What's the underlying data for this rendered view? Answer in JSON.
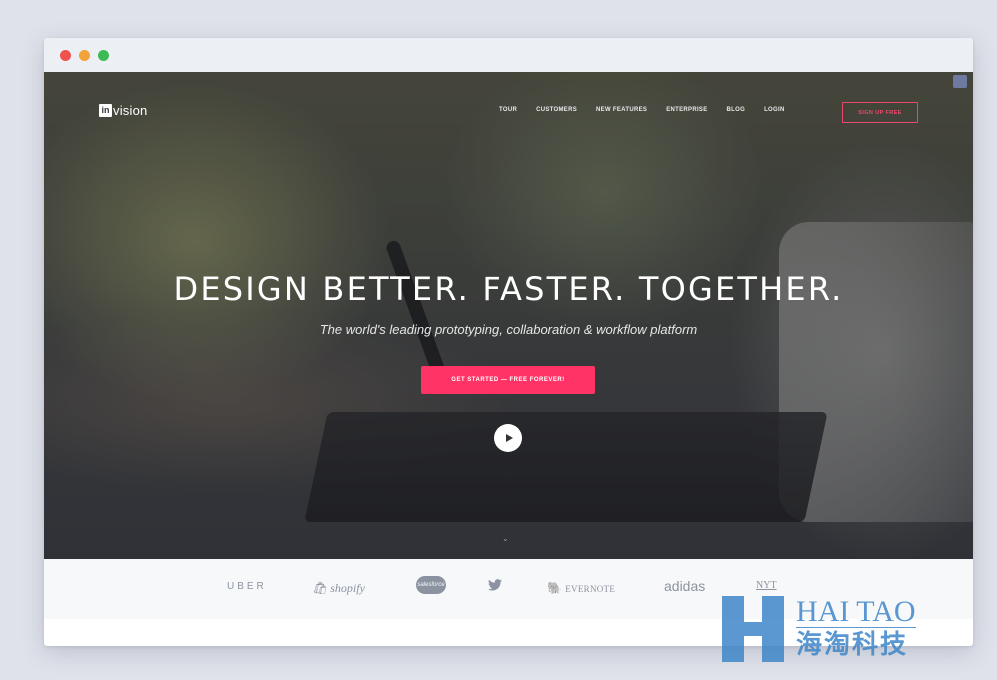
{
  "window": {
    "controls": [
      "close",
      "minimize",
      "maximize"
    ]
  },
  "header": {
    "logo_mark": "in",
    "logo_text": "vision",
    "nav": [
      {
        "label": "TOUR"
      },
      {
        "label": "CUSTOMERS"
      },
      {
        "label": "NEW FEATURES"
      },
      {
        "label": "ENTERPRISE"
      },
      {
        "label": "BLOG"
      },
      {
        "label": "LOGIN"
      }
    ],
    "signup_label": "SIGN UP FREE"
  },
  "hero": {
    "headline": "DESIGN BETTER. FASTER. TOGETHER.",
    "subheadline": "The world's leading prototyping, collaboration & workflow platform",
    "cta_label": "GET STARTED — FREE FOREVER!",
    "play_icon": "play-icon",
    "scroll_icon": "chevron-down-icon"
  },
  "customers": {
    "logos": [
      {
        "name": "UBER"
      },
      {
        "name": "shopify"
      },
      {
        "name": "salesforce"
      },
      {
        "name": "twitter"
      },
      {
        "name": "EVERNOTE"
      },
      {
        "name": "adidas"
      },
      {
        "name": "NYT"
      }
    ]
  },
  "watermark": {
    "en": "HAI TAO",
    "cn": "海淘科技"
  },
  "colors": {
    "accent": "#ff3366",
    "signup_border": "#e94a6c",
    "logo_gray": "#8c93a0",
    "watermark_blue": "#3f87c9"
  }
}
